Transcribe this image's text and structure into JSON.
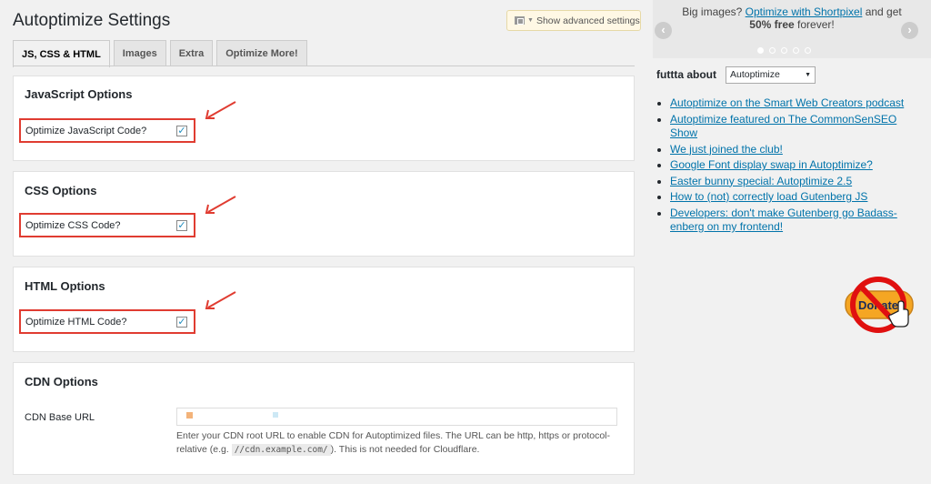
{
  "page": {
    "title": "Autoptimize Settings"
  },
  "advanced_toggle": {
    "label": "Show advanced settings"
  },
  "tabs": [
    {
      "label": "JS, CSS & HTML",
      "active": true
    },
    {
      "label": "Images",
      "active": false
    },
    {
      "label": "Extra",
      "active": false
    },
    {
      "label": "Optimize More!",
      "active": false
    }
  ],
  "js_options": {
    "title": "JavaScript Options",
    "option_label": "Optimize JavaScript Code?",
    "checked": true
  },
  "css_options": {
    "title": "CSS Options",
    "option_label": "Optimize CSS Code?",
    "checked": true
  },
  "html_options": {
    "title": "HTML Options",
    "option_label": "Optimize HTML Code?",
    "checked": true
  },
  "cdn_options": {
    "title": "CDN Options",
    "base_url_label": "CDN Base URL",
    "desc_before": "Enter your CDN root URL to enable CDN for Autoptimized files. The URL can be http, https or protocol-relative (e.g. ",
    "desc_code": "//cdn.example.com/",
    "desc_after": "). This is not needed for Cloudflare."
  },
  "promo": {
    "text_before": "Big images?",
    "link": "Optimize with Shortpixel",
    "text_and": "and get",
    "bold": "50% free",
    "text_after": "forever!",
    "prev_glyph": "‹",
    "next_glyph": "›",
    "dot_count": 5,
    "active_dot": 0
  },
  "news": {
    "label": "futtta about",
    "selected": "Autoptimize",
    "items": [
      "Autoptimize on the Smart Web Creators podcast",
      "Autoptimize featured on The CommonSenSEO Show",
      "We just joined the club!",
      "Google Font display swap in Autoptimize?",
      "Easter bunny special: Autoptimize 2.5",
      "How to (not) correctly load Gutenberg JS",
      "Developers: don't make Gutenberg go Badass-enberg on my frontend!"
    ]
  },
  "donate": {
    "text": "Donate",
    "icon": "no-sign-icon"
  },
  "colors": {
    "highlight": "#e03c31",
    "link": "#0073aa",
    "checkmark": "#1e8cbe"
  }
}
